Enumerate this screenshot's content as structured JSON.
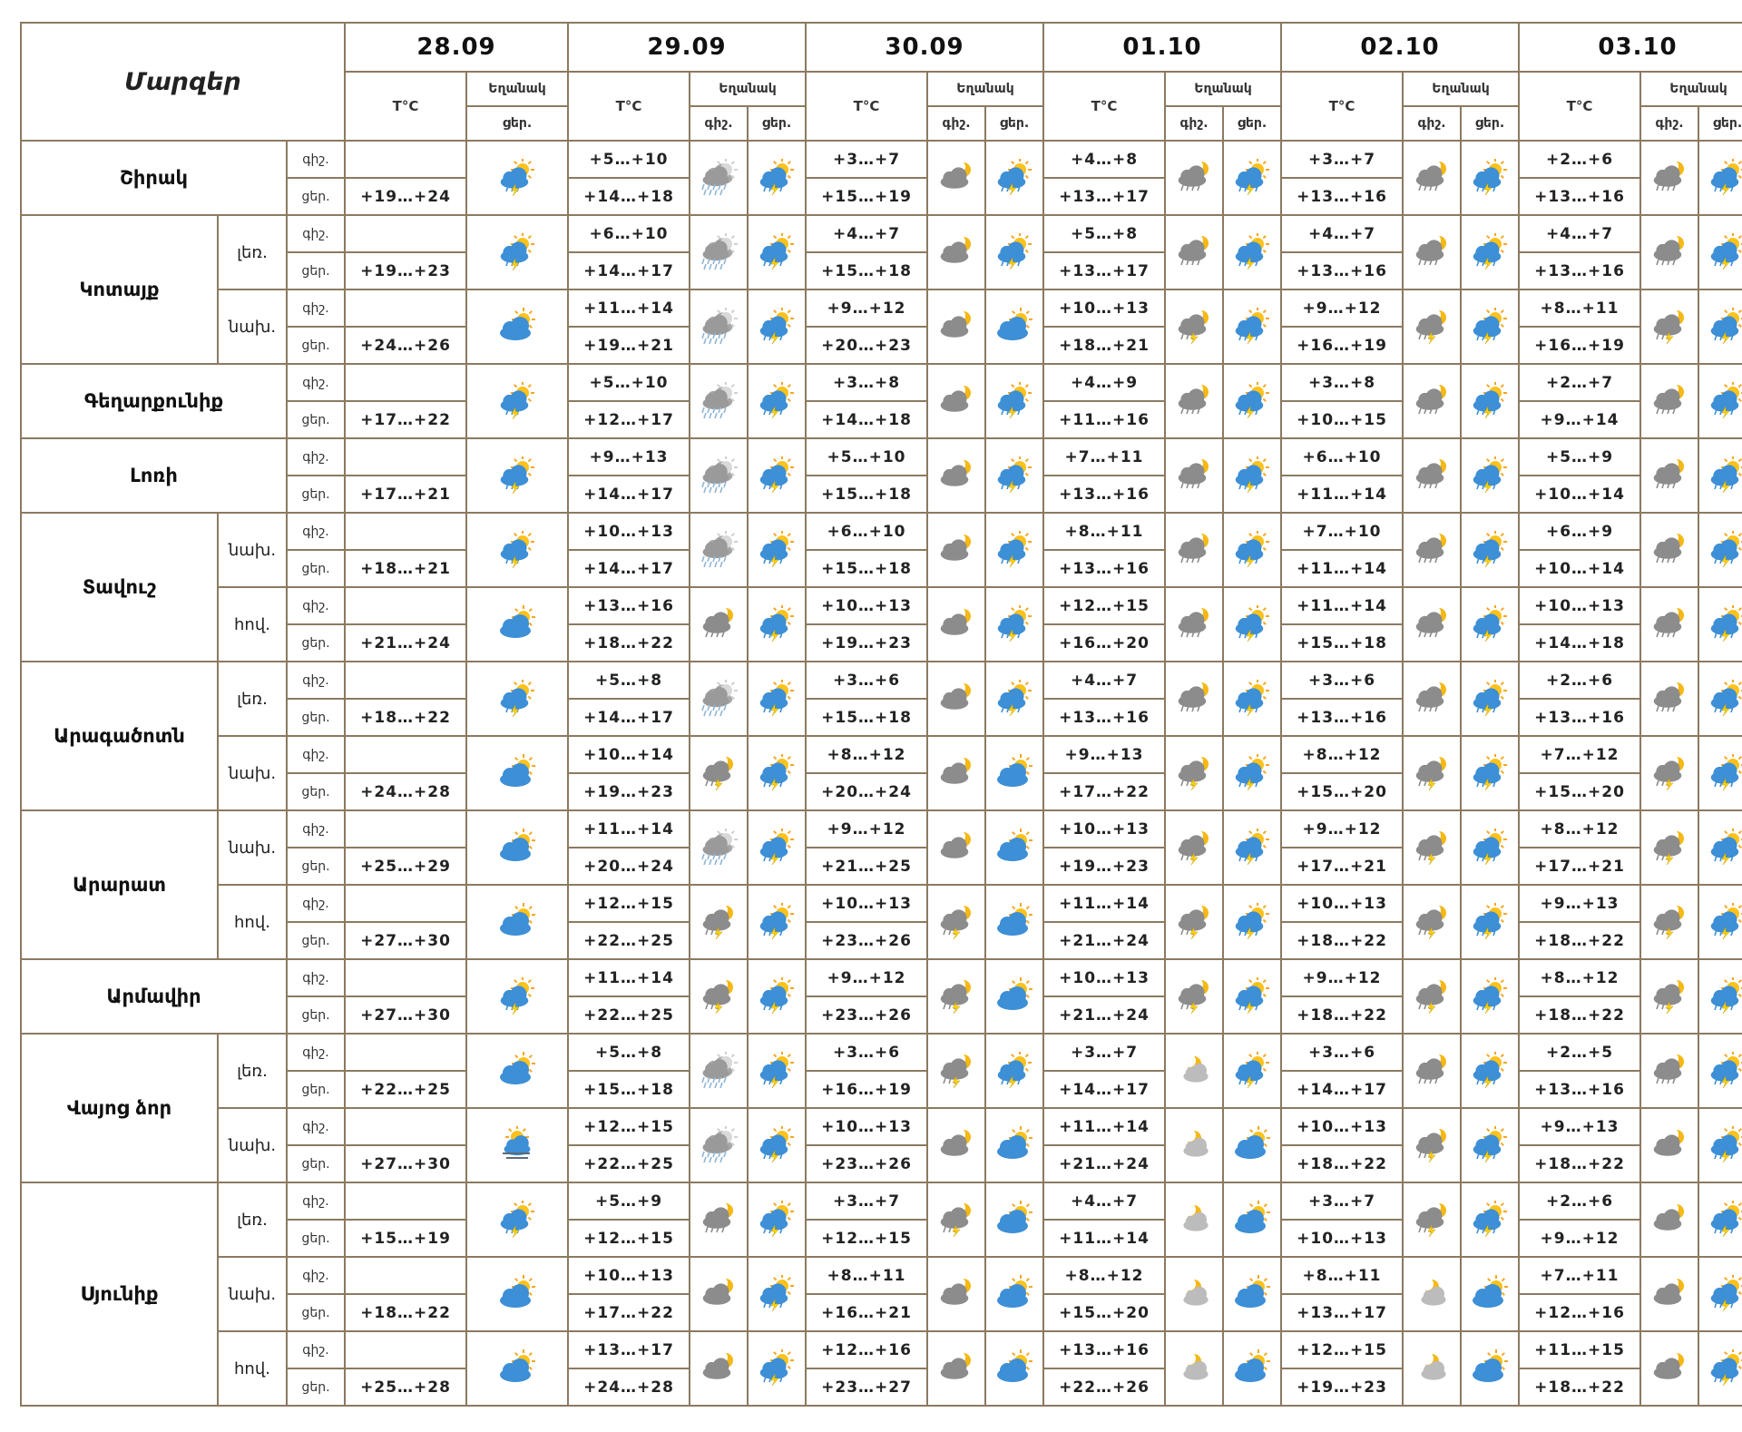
{
  "header": {
    "corner": "Մարզեր",
    "dates": [
      "28.09",
      "29.09",
      "30.09",
      "01.10",
      "02.10",
      "03.10"
    ],
    "temp_label": "T°C",
    "weather_label": "Եղանակ",
    "night": "գիշ.",
    "day": "ցեր."
  },
  "regions": [
    {
      "name": "Շիրակ",
      "subs": [
        {
          "label": "",
          "first": {
            "temp": "+19…+24",
            "icon": "sun-cloud-rain-icon"
          },
          "days": [
            {
              "night": "+5…+10",
              "day": "+14…+18",
              "ni": "cloud-heavy-rain-icon",
              "di": "sun-cloud-storm-icon"
            },
            {
              "night": "+3…+7",
              "day": "+15…+19",
              "ni": "moon-cloud-icon",
              "di": "sun-cloud-storm-icon"
            },
            {
              "night": "+4…+8",
              "day": "+13…+17",
              "ni": "moon-cloud-rain-icon",
              "di": "sun-cloud-storm-icon"
            },
            {
              "night": "+3…+7",
              "day": "+13…+16",
              "ni": "moon-cloud-rain-icon",
              "di": "sun-cloud-storm-icon"
            },
            {
              "night": "+2…+6",
              "day": "+13…+16",
              "ni": "moon-cloud-rain-icon",
              "di": "sun-cloud-storm-icon"
            }
          ]
        }
      ]
    },
    {
      "name": "Կոտայք",
      "subs": [
        {
          "label": "լեռ.",
          "first": {
            "temp": "+19…+23",
            "icon": "sun-cloud-rain-icon"
          },
          "days": [
            {
              "night": "+6…+10",
              "day": "+14…+17",
              "ni": "cloud-heavy-rain-icon",
              "di": "sun-cloud-storm-icon"
            },
            {
              "night": "+4…+7",
              "day": "+15…+18",
              "ni": "moon-cloud-icon",
              "di": "sun-cloud-storm-icon"
            },
            {
              "night": "+5…+8",
              "day": "+13…+17",
              "ni": "moon-cloud-rain-icon",
              "di": "sun-cloud-storm-icon"
            },
            {
              "night": "+4…+7",
              "day": "+13…+16",
              "ni": "moon-cloud-rain-icon",
              "di": "sun-cloud-storm-icon"
            },
            {
              "night": "+4…+7",
              "day": "+13…+16",
              "ni": "moon-cloud-rain-icon",
              "di": "sun-cloud-storm-icon"
            }
          ]
        },
        {
          "label": "նախ.",
          "first": {
            "temp": "+24…+26",
            "icon": "sun-cloud-icon"
          },
          "days": [
            {
              "night": "+11…+14",
              "day": "+19…+21",
              "ni": "cloud-heavy-rain-icon",
              "di": "sun-cloud-storm-icon"
            },
            {
              "night": "+9…+12",
              "day": "+20…+23",
              "ni": "moon-cloud-icon",
              "di": "sun-cloud-icon"
            },
            {
              "night": "+10…+13",
              "day": "+18…+21",
              "ni": "moon-cloud-storm-icon",
              "di": "sun-cloud-storm-icon"
            },
            {
              "night": "+9…+12",
              "day": "+16…+19",
              "ni": "moon-cloud-storm-icon",
              "di": "sun-cloud-storm-icon"
            },
            {
              "night": "+8…+11",
              "day": "+16…+19",
              "ni": "moon-cloud-storm-icon",
              "di": "sun-cloud-storm-icon"
            }
          ]
        }
      ]
    },
    {
      "name": "Գեղարքունիք",
      "subs": [
        {
          "label": "",
          "first": {
            "temp": "+17…+22",
            "icon": "sun-cloud-rain-icon"
          },
          "days": [
            {
              "night": "+5…+10",
              "day": "+12…+17",
              "ni": "cloud-heavy-rain-icon",
              "di": "sun-cloud-storm-icon"
            },
            {
              "night": "+3…+8",
              "day": "+14…+18",
              "ni": "moon-cloud-icon",
              "di": "sun-cloud-storm-icon"
            },
            {
              "night": "+4…+9",
              "day": "+11…+16",
              "ni": "moon-cloud-rain-icon",
              "di": "sun-cloud-storm-icon"
            },
            {
              "night": "+3…+8",
              "day": "+10…+15",
              "ni": "moon-cloud-rain-icon",
              "di": "sun-cloud-storm-icon"
            },
            {
              "night": "+2…+7",
              "day": "+9…+14",
              "ni": "moon-cloud-rain-icon",
              "di": "sun-cloud-storm-icon"
            }
          ]
        }
      ]
    },
    {
      "name": "Լոռի",
      "subs": [
        {
          "label": "",
          "first": {
            "temp": "+17…+21",
            "icon": "sun-cloud-rain-icon"
          },
          "days": [
            {
              "night": "+9…+13",
              "day": "+14…+17",
              "ni": "cloud-heavy-rain-icon",
              "di": "sun-cloud-storm-icon"
            },
            {
              "night": "+5…+10",
              "day": "+15…+18",
              "ni": "moon-cloud-icon",
              "di": "sun-cloud-storm-icon"
            },
            {
              "night": "+7…+11",
              "day": "+13…+16",
              "ni": "moon-cloud-rain-icon",
              "di": "sun-cloud-storm-icon"
            },
            {
              "night": "+6…+10",
              "day": "+11…+14",
              "ni": "moon-cloud-rain-icon",
              "di": "sun-cloud-storm-icon"
            },
            {
              "night": "+5…+9",
              "day": "+10…+14",
              "ni": "moon-cloud-rain-icon",
              "di": "sun-cloud-storm-icon"
            }
          ]
        }
      ]
    },
    {
      "name": "Տավուշ",
      "subs": [
        {
          "label": "նախ.",
          "first": {
            "temp": "+18…+21",
            "icon": "sun-cloud-rain-icon"
          },
          "days": [
            {
              "night": "+10…+13",
              "day": "+14…+17",
              "ni": "cloud-heavy-rain-icon",
              "di": "sun-cloud-storm-icon"
            },
            {
              "night": "+6…+10",
              "day": "+15…+18",
              "ni": "moon-cloud-icon",
              "di": "sun-cloud-storm-icon"
            },
            {
              "night": "+8…+11",
              "day": "+13…+16",
              "ni": "moon-cloud-rain-icon",
              "di": "sun-cloud-storm-icon"
            },
            {
              "night": "+7…+10",
              "day": "+11…+14",
              "ni": "moon-cloud-rain-icon",
              "di": "sun-cloud-storm-icon"
            },
            {
              "night": "+6…+9",
              "day": "+10…+14",
              "ni": "moon-cloud-rain-icon",
              "di": "sun-cloud-storm-icon"
            }
          ]
        },
        {
          "label": "հով.",
          "first": {
            "temp": "+21…+24",
            "icon": "sun-cloud-icon"
          },
          "days": [
            {
              "night": "+13…+16",
              "day": "+18…+22",
              "ni": "moon-cloud-rain-icon",
              "di": "sun-cloud-storm-icon"
            },
            {
              "night": "+10…+13",
              "day": "+19…+23",
              "ni": "moon-cloud-icon",
              "di": "sun-cloud-storm-icon"
            },
            {
              "night": "+12…+15",
              "day": "+16…+20",
              "ni": "moon-cloud-rain-icon",
              "di": "sun-cloud-storm-icon"
            },
            {
              "night": "+11…+14",
              "day": "+15…+18",
              "ni": "moon-cloud-rain-icon",
              "di": "sun-cloud-storm-icon"
            },
            {
              "night": "+10…+13",
              "day": "+14…+18",
              "ni": "moon-cloud-rain-icon",
              "di": "sun-cloud-storm-icon"
            }
          ]
        }
      ]
    },
    {
      "name": "Արագածոտն",
      "subs": [
        {
          "label": "լեռ.",
          "first": {
            "temp": "+18…+22",
            "icon": "sun-cloud-rain-icon"
          },
          "days": [
            {
              "night": "+5…+8",
              "day": "+14…+17",
              "ni": "cloud-heavy-rain-icon",
              "di": "sun-cloud-storm-icon"
            },
            {
              "night": "+3…+6",
              "day": "+15…+18",
              "ni": "moon-cloud-icon",
              "di": "sun-cloud-storm-icon"
            },
            {
              "night": "+4…+7",
              "day": "+13…+16",
              "ni": "moon-cloud-rain-icon",
              "di": "sun-cloud-storm-icon"
            },
            {
              "night": "+3…+6",
              "day": "+13…+16",
              "ni": "moon-cloud-rain-icon",
              "di": "sun-cloud-storm-icon"
            },
            {
              "night": "+2…+6",
              "day": "+13…+16",
              "ni": "moon-cloud-rain-icon",
              "di": "sun-cloud-storm-icon"
            }
          ]
        },
        {
          "label": "նախ.",
          "first": {
            "temp": "+24…+28",
            "icon": "sun-cloud-icon"
          },
          "days": [
            {
              "night": "+10…+14",
              "day": "+19…+23",
              "ni": "moon-cloud-storm-icon",
              "di": "sun-cloud-storm-icon"
            },
            {
              "night": "+8…+12",
              "day": "+20…+24",
              "ni": "moon-cloud-icon",
              "di": "sun-cloud-icon"
            },
            {
              "night": "+9…+13",
              "day": "+17…+22",
              "ni": "moon-cloud-storm-icon",
              "di": "sun-cloud-storm-icon"
            },
            {
              "night": "+8…+12",
              "day": "+15…+20",
              "ni": "moon-cloud-storm-icon",
              "di": "sun-cloud-storm-icon"
            },
            {
              "night": "+7…+12",
              "day": "+15…+20",
              "ni": "moon-cloud-storm-icon",
              "di": "sun-cloud-storm-icon"
            }
          ]
        }
      ]
    },
    {
      "name": "Արարատ",
      "subs": [
        {
          "label": "նախ.",
          "first": {
            "temp": "+25…+29",
            "icon": "sun-cloud-icon"
          },
          "days": [
            {
              "night": "+11…+14",
              "day": "+20…+24",
              "ni": "cloud-heavy-rain-icon",
              "di": "sun-cloud-storm-icon"
            },
            {
              "night": "+9…+12",
              "day": "+21…+25",
              "ni": "moon-cloud-icon",
              "di": "sun-cloud-icon"
            },
            {
              "night": "+10…+13",
              "day": "+19…+23",
              "ni": "moon-cloud-storm-icon",
              "di": "sun-cloud-storm-icon"
            },
            {
              "night": "+9…+12",
              "day": "+17…+21",
              "ni": "moon-cloud-storm-icon",
              "di": "sun-cloud-storm-icon"
            },
            {
              "night": "+8…+12",
              "day": "+17…+21",
              "ni": "moon-cloud-storm-icon",
              "di": "sun-cloud-storm-icon"
            }
          ]
        },
        {
          "label": "հով.",
          "first": {
            "temp": "+27…+30",
            "icon": "sun-cloud-icon"
          },
          "days": [
            {
              "night": "+12…+15",
              "day": "+22…+25",
              "ni": "moon-cloud-storm-icon",
              "di": "sun-cloud-storm-icon"
            },
            {
              "night": "+10…+13",
              "day": "+23…+26",
              "ni": "moon-cloud-storm-icon",
              "di": "sun-cloud-icon"
            },
            {
              "night": "+11…+14",
              "day": "+21…+24",
              "ni": "moon-cloud-storm-icon",
              "di": "sun-cloud-storm-icon"
            },
            {
              "night": "+10…+13",
              "day": "+18…+22",
              "ni": "moon-cloud-storm-icon",
              "di": "sun-cloud-storm-icon"
            },
            {
              "night": "+9…+13",
              "day": "+18…+22",
              "ni": "moon-cloud-storm-icon",
              "di": "sun-cloud-storm-icon"
            }
          ]
        }
      ]
    },
    {
      "name": "Արմավիր",
      "subs": [
        {
          "label": "",
          "first": {
            "temp": "+27…+30",
            "icon": "sun-cloud-rain-icon"
          },
          "days": [
            {
              "night": "+11…+14",
              "day": "+22…+25",
              "ni": "moon-cloud-storm-icon",
              "di": "sun-cloud-storm-icon"
            },
            {
              "night": "+9…+12",
              "day": "+23…+26",
              "ni": "moon-cloud-storm-icon",
              "di": "sun-cloud-icon"
            },
            {
              "night": "+10…+13",
              "day": "+21…+24",
              "ni": "moon-cloud-storm-icon",
              "di": "sun-cloud-storm-icon"
            },
            {
              "night": "+9…+12",
              "day": "+18…+22",
              "ni": "moon-cloud-storm-icon",
              "di": "sun-cloud-storm-icon"
            },
            {
              "night": "+8…+12",
              "day": "+18…+22",
              "ni": "moon-cloud-storm-icon",
              "di": "sun-cloud-storm-icon"
            }
          ]
        }
      ]
    },
    {
      "name": "Վայոց ձոր",
      "subs": [
        {
          "label": "լեռ.",
          "first": {
            "temp": "+22…+25",
            "icon": "sun-cloud-icon"
          },
          "days": [
            {
              "night": "+5…+8",
              "day": "+15…+18",
              "ni": "cloud-heavy-rain-icon",
              "di": "sun-cloud-storm-icon"
            },
            {
              "night": "+3…+6",
              "day": "+16…+19",
              "ni": "moon-cloud-storm-icon",
              "di": "sun-cloud-storm-icon"
            },
            {
              "night": "+3…+7",
              "day": "+14…+17",
              "ni": "moon-light-cloud-icon",
              "di": "sun-cloud-storm-icon"
            },
            {
              "night": "+3…+6",
              "day": "+14…+17",
              "ni": "moon-cloud-rain-icon",
              "di": "sun-cloud-storm-icon"
            },
            {
              "night": "+2…+5",
              "day": "+13…+16",
              "ni": "moon-cloud-rain-icon",
              "di": "sun-cloud-storm-icon"
            }
          ]
        },
        {
          "label": "նախ.",
          "first": {
            "temp": "+27…+30",
            "icon": "sun-fog-icon"
          },
          "days": [
            {
              "night": "+12…+15",
              "day": "+22…+25",
              "ni": "cloud-heavy-rain-icon",
              "di": "sun-cloud-storm-icon"
            },
            {
              "night": "+10…+13",
              "day": "+23…+26",
              "ni": "moon-cloud-icon",
              "di": "sun-cloud-icon"
            },
            {
              "night": "+11…+14",
              "day": "+21…+24",
              "ni": "moon-light-cloud-icon",
              "di": "sun-cloud-icon"
            },
            {
              "night": "+10…+13",
              "day": "+18…+22",
              "ni": "moon-cloud-storm-icon",
              "di": "sun-cloud-storm-icon"
            },
            {
              "night": "+9…+13",
              "day": "+18…+22",
              "ni": "moon-cloud-icon",
              "di": "sun-cloud-storm-icon"
            }
          ]
        }
      ]
    },
    {
      "name": "Սյունիք",
      "subs": [
        {
          "label": "լեռ.",
          "first": {
            "temp": "+15…+19",
            "icon": "sun-cloud-rain-icon"
          },
          "days": [
            {
              "night": "+5…+9",
              "day": "+12…+15",
              "ni": "moon-cloud-rain-icon",
              "di": "sun-cloud-storm-icon"
            },
            {
              "night": "+3…+7",
              "day": "+12…+15",
              "ni": "moon-cloud-storm-icon",
              "di": "sun-cloud-icon"
            },
            {
              "night": "+4…+7",
              "day": "+11…+14",
              "ni": "moon-light-cloud-icon",
              "di": "sun-cloud-icon"
            },
            {
              "night": "+3…+7",
              "day": "+10…+13",
              "ni": "moon-cloud-storm-icon",
              "di": "sun-cloud-storm-icon"
            },
            {
              "night": "+2…+6",
              "day": "+9…+12",
              "ni": "moon-cloud-icon",
              "di": "sun-cloud-storm-icon"
            }
          ]
        },
        {
          "label": "նախ.",
          "first": {
            "temp": "+18…+22",
            "icon": "sun-cloud-icon"
          },
          "days": [
            {
              "night": "+10…+13",
              "day": "+17…+22",
              "ni": "moon-cloud-icon",
              "di": "sun-cloud-storm-icon"
            },
            {
              "night": "+8…+11",
              "day": "+16…+21",
              "ni": "moon-cloud-icon",
              "di": "sun-cloud-icon"
            },
            {
              "night": "+8…+12",
              "day": "+15…+20",
              "ni": "moon-light-cloud-icon",
              "di": "sun-cloud-icon"
            },
            {
              "night": "+8…+11",
              "day": "+13…+17",
              "ni": "moon-light-cloud-icon",
              "di": "sun-cloud-icon"
            },
            {
              "night": "+7…+11",
              "day": "+12…+16",
              "ni": "moon-cloud-icon",
              "di": "sun-cloud-storm-icon"
            }
          ]
        },
        {
          "label": "հով.",
          "first": {
            "temp": "+25…+28",
            "icon": "sun-cloud-icon"
          },
          "days": [
            {
              "night": "+13…+17",
              "day": "+24…+28",
              "ni": "moon-cloud-icon",
              "di": "sun-cloud-storm-icon"
            },
            {
              "night": "+12…+16",
              "day": "+23…+27",
              "ni": "moon-cloud-icon",
              "di": "sun-cloud-icon"
            },
            {
              "night": "+13…+16",
              "day": "+22…+26",
              "ni": "moon-light-cloud-icon",
              "di": "sun-cloud-icon"
            },
            {
              "night": "+12…+15",
              "day": "+19…+23",
              "ni": "moon-light-cloud-icon",
              "di": "sun-cloud-icon"
            },
            {
              "night": "+11…+15",
              "day": "+18…+22",
              "ni": "moon-cloud-icon",
              "di": "sun-cloud-storm-icon"
            }
          ]
        }
      ]
    }
  ]
}
